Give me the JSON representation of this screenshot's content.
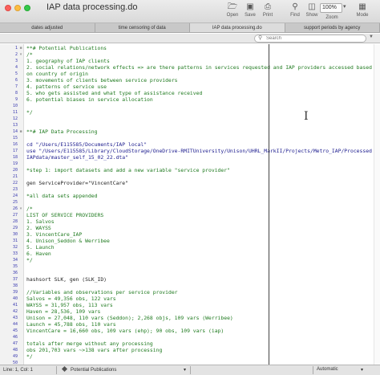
{
  "window": {
    "title": "IAP data processing.do"
  },
  "toolbar": {
    "open_label": "Open",
    "save_label": "Save",
    "print_label": "Print",
    "find_label": "Find",
    "show_label": "Show",
    "zoom_label": "Zoom",
    "mode_label": "Mode",
    "zoom_value": "100%"
  },
  "tabs": [
    {
      "label": "dates adjusted"
    },
    {
      "label": "time censoring of data"
    },
    {
      "label": "IAP data processing.do"
    },
    {
      "label": "support periods by agency"
    }
  ],
  "search": {
    "placeholder": "Search"
  },
  "gutter": {
    "line_numbers": [
      "1",
      "2",
      "3",
      "4",
      "5",
      "6",
      "7",
      "8",
      "9",
      "10",
      "11",
      "12",
      "13",
      "14",
      "15",
      "16",
      "17",
      "18",
      "19",
      "20",
      "21",
      "22",
      "23",
      "24",
      "25",
      "26",
      "27",
      "28",
      "29",
      "30",
      "31",
      "32",
      "33",
      "34",
      "35",
      "36",
      "37",
      "38",
      "39",
      "40",
      "41",
      "42",
      "43",
      "44",
      "45",
      "46",
      "47",
      "48",
      "49",
      "50",
      "51"
    ]
  },
  "code": {
    "lines": [
      {
        "text": "**# Potential Publications",
        "kind": "comment"
      },
      {
        "text": "/*",
        "kind": "comment"
      },
      {
        "text": "1. geography of IAP clients",
        "kind": "comment"
      },
      {
        "text": "2. social relations/network effects => are there patterns in services requested and IAP providers accessed based",
        "kind": "comment"
      },
      {
        "text": "on country of origin",
        "kind": "comment"
      },
      {
        "text": "3. movements of clients between service providers",
        "kind": "comment"
      },
      {
        "text": "4. patterns of service use",
        "kind": "comment"
      },
      {
        "text": "5. who gets assisted and what type of assistance received",
        "kind": "comment"
      },
      {
        "text": "6. potential biases in service allocation",
        "kind": "comment"
      },
      {
        "text": "",
        "kind": "blank"
      },
      {
        "text": "*/",
        "kind": "comment"
      },
      {
        "text": "",
        "kind": "blank"
      },
      {
        "text": "",
        "kind": "blank"
      },
      {
        "text": "**# IAP Data Processing",
        "kind": "comment"
      },
      {
        "text": "",
        "kind": "blank"
      },
      {
        "text": "cd \"/Users/E115585/Documents/IAP local\"",
        "kind": "kw"
      },
      {
        "text": "use \"/Users/E115585/Library/CloudStorage/OneDrive-RMITUniversity/Unison/UHRL_MarkII/Projects/Metro_IAP/Processed",
        "kind": "kw"
      },
      {
        "text": "IAPdata/master_self_15_02_22.dta\"",
        "kind": "kw"
      },
      {
        "text": "",
        "kind": "blank"
      },
      {
        "text": "*step 1: import datasets and add a new variable \"service provider\"",
        "kind": "comment"
      },
      {
        "text": "",
        "kind": "blank"
      },
      {
        "text": "gen ServiceProvider=\"VincentCare\"",
        "kind": "plain"
      },
      {
        "text": "",
        "kind": "blank"
      },
      {
        "text": "*all data sets appended",
        "kind": "comment"
      },
      {
        "text": "",
        "kind": "blank"
      },
      {
        "text": "/*",
        "kind": "comment"
      },
      {
        "text": "LIST OF SERVICE PROVIDERS",
        "kind": "comment"
      },
      {
        "text": "1. Salvos",
        "kind": "comment"
      },
      {
        "text": "2. WAYSS",
        "kind": "comment"
      },
      {
        "text": "3. VincentCare_IAP",
        "kind": "comment"
      },
      {
        "text": "4. Unison_Seddon & Werribee",
        "kind": "comment"
      },
      {
        "text": "5. Launch",
        "kind": "comment"
      },
      {
        "text": "6. Haven",
        "kind": "comment"
      },
      {
        "text": "*/",
        "kind": "comment"
      },
      {
        "text": "",
        "kind": "blank"
      },
      {
        "text": "",
        "kind": "blank"
      },
      {
        "text": "hashsort SLK, gen (SLK_ID)",
        "kind": "plain"
      },
      {
        "text": "",
        "kind": "blank"
      },
      {
        "text": "//Variables and observations per service provider",
        "kind": "comment"
      },
      {
        "text": "Salvos = 49,356 obs, 122 vars",
        "kind": "comment"
      },
      {
        "text": "WAYSS = 31,957 obs, 113 vars",
        "kind": "comment"
      },
      {
        "text": "Haven = 28,536, 109 vars",
        "kind": "comment"
      },
      {
        "text": "Unison = 27,048, 110 vars (Seddon); 2,268 objs, 109 vars (Werribee)",
        "kind": "comment"
      },
      {
        "text": "Launch = 45,788 obs, 110 vars",
        "kind": "comment"
      },
      {
        "text": "VincentCare = 16,660 obs, 109 vars (ehp); 90 obs, 109 vars (iap)",
        "kind": "comment"
      },
      {
        "text": "",
        "kind": "blank"
      },
      {
        "text": "totals after merge without any processing",
        "kind": "comment"
      },
      {
        "text": "obs 201,703 vars ~>138 vars after processing",
        "kind": "comment"
      },
      {
        "text": "*/",
        "kind": "comment"
      },
      {
        "text": "",
        "kind": "blank"
      },
      {
        "text": "/* Initial findings before subsetting data to only household heads",
        "kind": "comment"
      }
    ]
  },
  "status": {
    "position": "Line: 1, Col: 1",
    "section": "Potential Publications",
    "encoding": "Automatic"
  },
  "colors": {
    "comment": "#1f7a1f",
    "keyword": "#202090",
    "line_number": "#3a3ab0"
  }
}
